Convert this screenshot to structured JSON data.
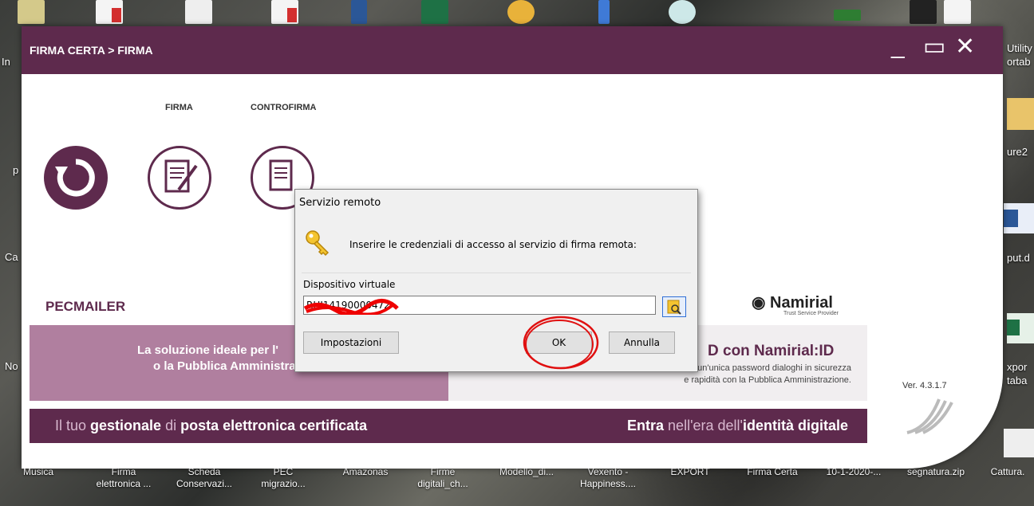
{
  "desktop": {
    "top_icons": [
      "file-icon",
      "pdf-icon",
      "document-icon",
      "pdf-icon",
      "word-icon",
      "excel-icon",
      "chrome-icon",
      "folder-icon",
      "app-icon",
      "terminal-icon",
      "pdf-icon",
      "folder-icon"
    ],
    "left_labels": [
      "In",
      "p",
      "Ca",
      "No"
    ],
    "right_labels": [
      "Utility",
      "ortab",
      "ure2",
      "put.d",
      "xpor",
      "taba"
    ],
    "bottom_labels": [
      {
        "line1": "Musica",
        "line2": ""
      },
      {
        "line1": "Firma",
        "line2": "elettronica ..."
      },
      {
        "line1": "Scheda",
        "line2": "Conservazi..."
      },
      {
        "line1": "PEC",
        "line2": "migrazio..."
      },
      {
        "line1": "Amazonas",
        "line2": ""
      },
      {
        "line1": "Firme",
        "line2": "digitali_ch..."
      },
      {
        "line1": "Modello_di...",
        "line2": ""
      },
      {
        "line1": "Vexento -",
        "line2": "Happiness...."
      },
      {
        "line1": "EXPORT",
        "line2": ""
      },
      {
        "line1": "Firma Certa",
        "line2": ""
      },
      {
        "line1": "10-1-2020-...",
        "line2": ""
      },
      {
        "line1": "segnatura.zip",
        "line2": ""
      },
      {
        "line1": "Cattura.",
        "line2": ""
      }
    ]
  },
  "app": {
    "title": "FIRMA CERTA > FIRMA",
    "window_controls": {
      "minimize": "_",
      "maximize": "▭",
      "close": "✕"
    },
    "tabs": [
      "FIRMA",
      "CONTROFIRMA"
    ],
    "icons": [
      "back-icon",
      "sign-document-icon",
      "countersign-document-icon"
    ],
    "banner": {
      "pec_logo": "PECMAILER",
      "pec_tagline_1": "La soluzione ideale per l'",
      "pec_tagline_2": "o la Pubblica Amministrazione.",
      "footer_left_1": "Il tuo ",
      "footer_left_2": "gestionale",
      "footer_left_3": " di ",
      "footer_left_4": "posta elettronica certificata",
      "footer_right_1": "Entra",
      "footer_right_2": " nell'era dell'",
      "footer_right_3": "identità digitale",
      "namirial": "Namirial",
      "namirial_sub": "Trust Service Provider",
      "spid_title": "D con Namirial",
      "spid_title_suffix": "ID",
      "spid_text_1": "Con un'unica password dialoghi in sicurezza",
      "spid_text_2": "e rapidità con la Pubblica Amministrazione."
    },
    "version": "Ver. 4.3.1.7",
    "brand_color": "#5e2a4d"
  },
  "dialog": {
    "title": "Servizio remoto",
    "message": "Inserire le credenziali di accesso al servizio di firma remota:",
    "field_label": "Dispositivo virtuale",
    "field_value": "RHI14190000472",
    "buttons": {
      "settings": "Impostazioni",
      "ok": "OK",
      "cancel": "Annulla"
    }
  }
}
